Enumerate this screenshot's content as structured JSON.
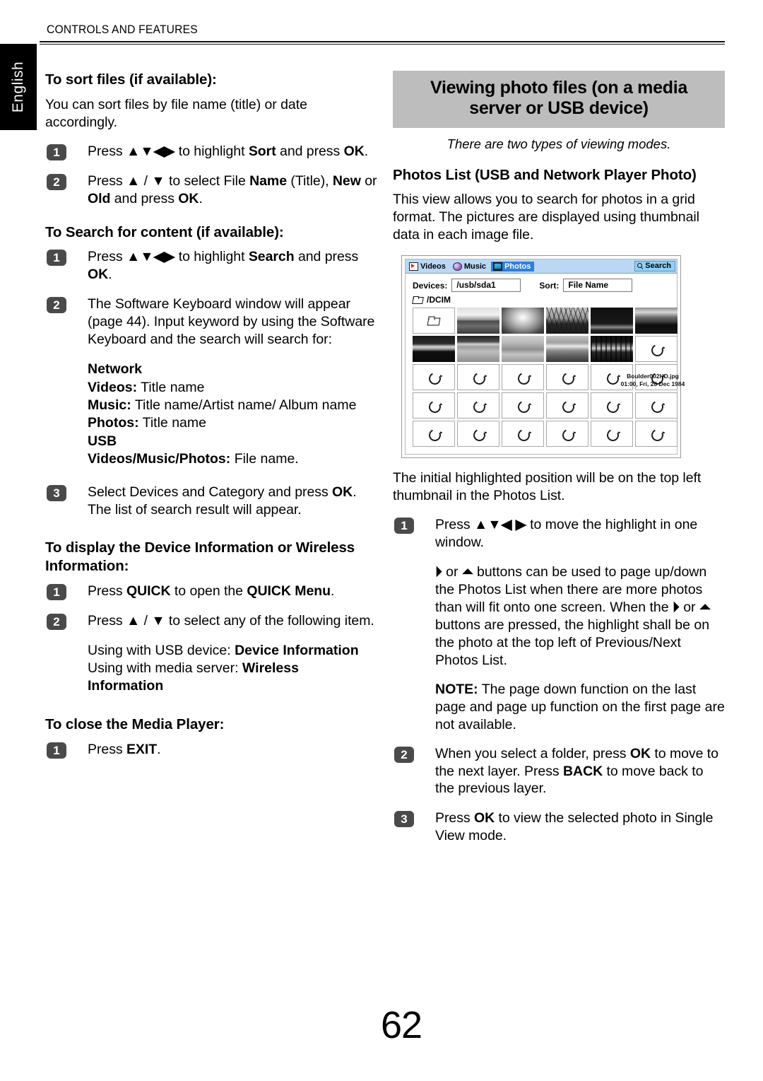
{
  "language_tab": "English",
  "running_head": "CONTROLS AND FEATURES",
  "page_number": "62",
  "left_column": {
    "section1": {
      "heading": "To sort files (if available):",
      "intro": "You can sort files by file name (title) or date accordingly.",
      "steps": [
        {
          "num": "1",
          "text_parts": [
            "Press ",
            "▲▼◀▶",
            " to highlight ",
            "Sort",
            " and press ",
            "OK",
            "."
          ]
        },
        {
          "num": "2",
          "text_parts": [
            "Press ",
            "▲",
            " / ",
            "▼",
            " to select File ",
            "Name",
            " (Title), ",
            "New",
            " or ",
            "Old",
            " and press ",
            "OK",
            "."
          ]
        }
      ]
    },
    "section2": {
      "heading": "To Search for content (if available):",
      "steps": [
        {
          "num": "1",
          "text": "Press ▲▼◀▶ to highlight Search and press OK."
        },
        {
          "num": "2",
          "text": "The Software Keyboard window will appear (page 44). Input keyword by using the Software Keyboard and the search will search for:"
        },
        {
          "num": "3",
          "text": "Select Devices and Category and press OK. The list of search result will appear."
        }
      ],
      "search_targets": {
        "network_label": "Network",
        "network_videos_label": "Videos:",
        "network_videos_value": "Title name",
        "network_music_label": "Music:",
        "network_music_value": "Title name/Artist name/ Album name",
        "network_photos_label": "Photos:",
        "network_photos_value": "Title name",
        "usb_label": "USB",
        "usb_files_label": "Videos/Music/Photos:",
        "usb_files_value": "File name."
      }
    },
    "section3": {
      "heading": "To display the Device Information or Wireless Information:",
      "step1_prefix": "Press ",
      "step1_quick": "QUICK",
      "step1_mid": " to open the ",
      "step1_menu": "QUICK Menu",
      "step1_end": ".",
      "step2": "Press ▲ / ▼ to select any of the following item.",
      "usb_line_label": "Using with USB device: ",
      "usb_line_value": "Device Information",
      "server_line_label": "Using with media server: ",
      "server_line_value": "Wireless Information"
    },
    "section4": {
      "heading": "To close the Media Player:",
      "step1_prefix": "Press ",
      "step1_key": "EXIT",
      "step1_end": "."
    }
  },
  "right_column": {
    "title_line1": "Viewing photo files (on a media",
    "title_line2": "server or USB device)",
    "subtitle": "There are two types of viewing modes.",
    "heading": "Photos List (USB and Network Player Photo)",
    "body": "This view allows you to search for photos in a grid format. The pictures are displayed using thumbnail data in each image file.",
    "after_figure_body": "The initial highlighted position will be on the top left thumbnail in the Photos List.",
    "step1": {
      "num": "1",
      "prefix": "Press ",
      "arrows": "▲▼◀ ▶",
      "suffix": " to move the highlight in one window."
    },
    "page_updown_paragraph": {
      "p1": " or ",
      "p2": " buttons can be used to page up/down the Photos List when there are more photos than will fit onto one screen. When the ",
      "p3": " or ",
      "p4": " buttons are pressed, the highlight shall be on the photo at the top left of Previous/Next Photos List."
    },
    "note": {
      "label": "NOTE:",
      "text": " The page down function on the last page and page up function on the first page are not available."
    },
    "step2": {
      "num": "2",
      "t1": "When you select a folder, press ",
      "k1": "OK",
      "t2": " to move to the next layer. Press ",
      "k2": "BACK",
      "t3": " to move back to the previous layer."
    },
    "step3": {
      "num": "3",
      "t1": "Press ",
      "k1": "OK",
      "t2": " to view the selected photo in Single View mode."
    }
  },
  "figure": {
    "tabs": [
      {
        "label": "Videos",
        "icon": "video-icon",
        "active": false
      },
      {
        "label": "Music",
        "icon": "music-disc-icon",
        "active": false
      },
      {
        "label": "Photos",
        "icon": "photo-icon",
        "active": true
      }
    ],
    "search_button": "Search",
    "devices_label": "Devices:",
    "devices_value": "/usb/sda1",
    "sort_label": "Sort:",
    "sort_value": "File Name",
    "path": "/DCIM",
    "selected_file_name": "Boulder002HD.jpg",
    "selected_file_date": "01:00, Fri, 28 Dec 1984",
    "grid": {
      "columns": 6,
      "rows": 5,
      "cells": [
        {
          "type": "folder"
        },
        {
          "type": "photo",
          "style": "ph1"
        },
        {
          "type": "photo",
          "style": "ph2"
        },
        {
          "type": "photo",
          "style": "ph3"
        },
        {
          "type": "photo",
          "style": "ph4"
        },
        {
          "type": "photo",
          "style": "ph5"
        },
        {
          "type": "photo",
          "style": "ph6"
        },
        {
          "type": "photo",
          "style": "ph7"
        },
        {
          "type": "photo",
          "style": "ph8"
        },
        {
          "type": "photo",
          "style": "ph9"
        },
        {
          "type": "photo",
          "style": "ph10"
        },
        {
          "type": "loading"
        },
        {
          "type": "loading"
        },
        {
          "type": "loading"
        },
        {
          "type": "loading"
        },
        {
          "type": "loading"
        },
        {
          "type": "loading"
        },
        {
          "type": "loading"
        },
        {
          "type": "loading"
        },
        {
          "type": "loading"
        },
        {
          "type": "loading"
        },
        {
          "type": "loading"
        },
        {
          "type": "loading"
        },
        {
          "type": "loading"
        },
        {
          "type": "loading"
        },
        {
          "type": "loading"
        },
        {
          "type": "loading"
        },
        {
          "type": "loading"
        },
        {
          "type": "loading"
        },
        {
          "type": "loading"
        }
      ]
    }
  },
  "colors": {
    "title_bar_bg": "#bdbdbd",
    "step_marker_bg": "#4a4a4a",
    "tabbar_bg": "#b9d8f5",
    "active_tab_bg": "#2f7fe0",
    "search_btn_bg": "#8fd0f5",
    "language_tab_bg": "#000000"
  }
}
